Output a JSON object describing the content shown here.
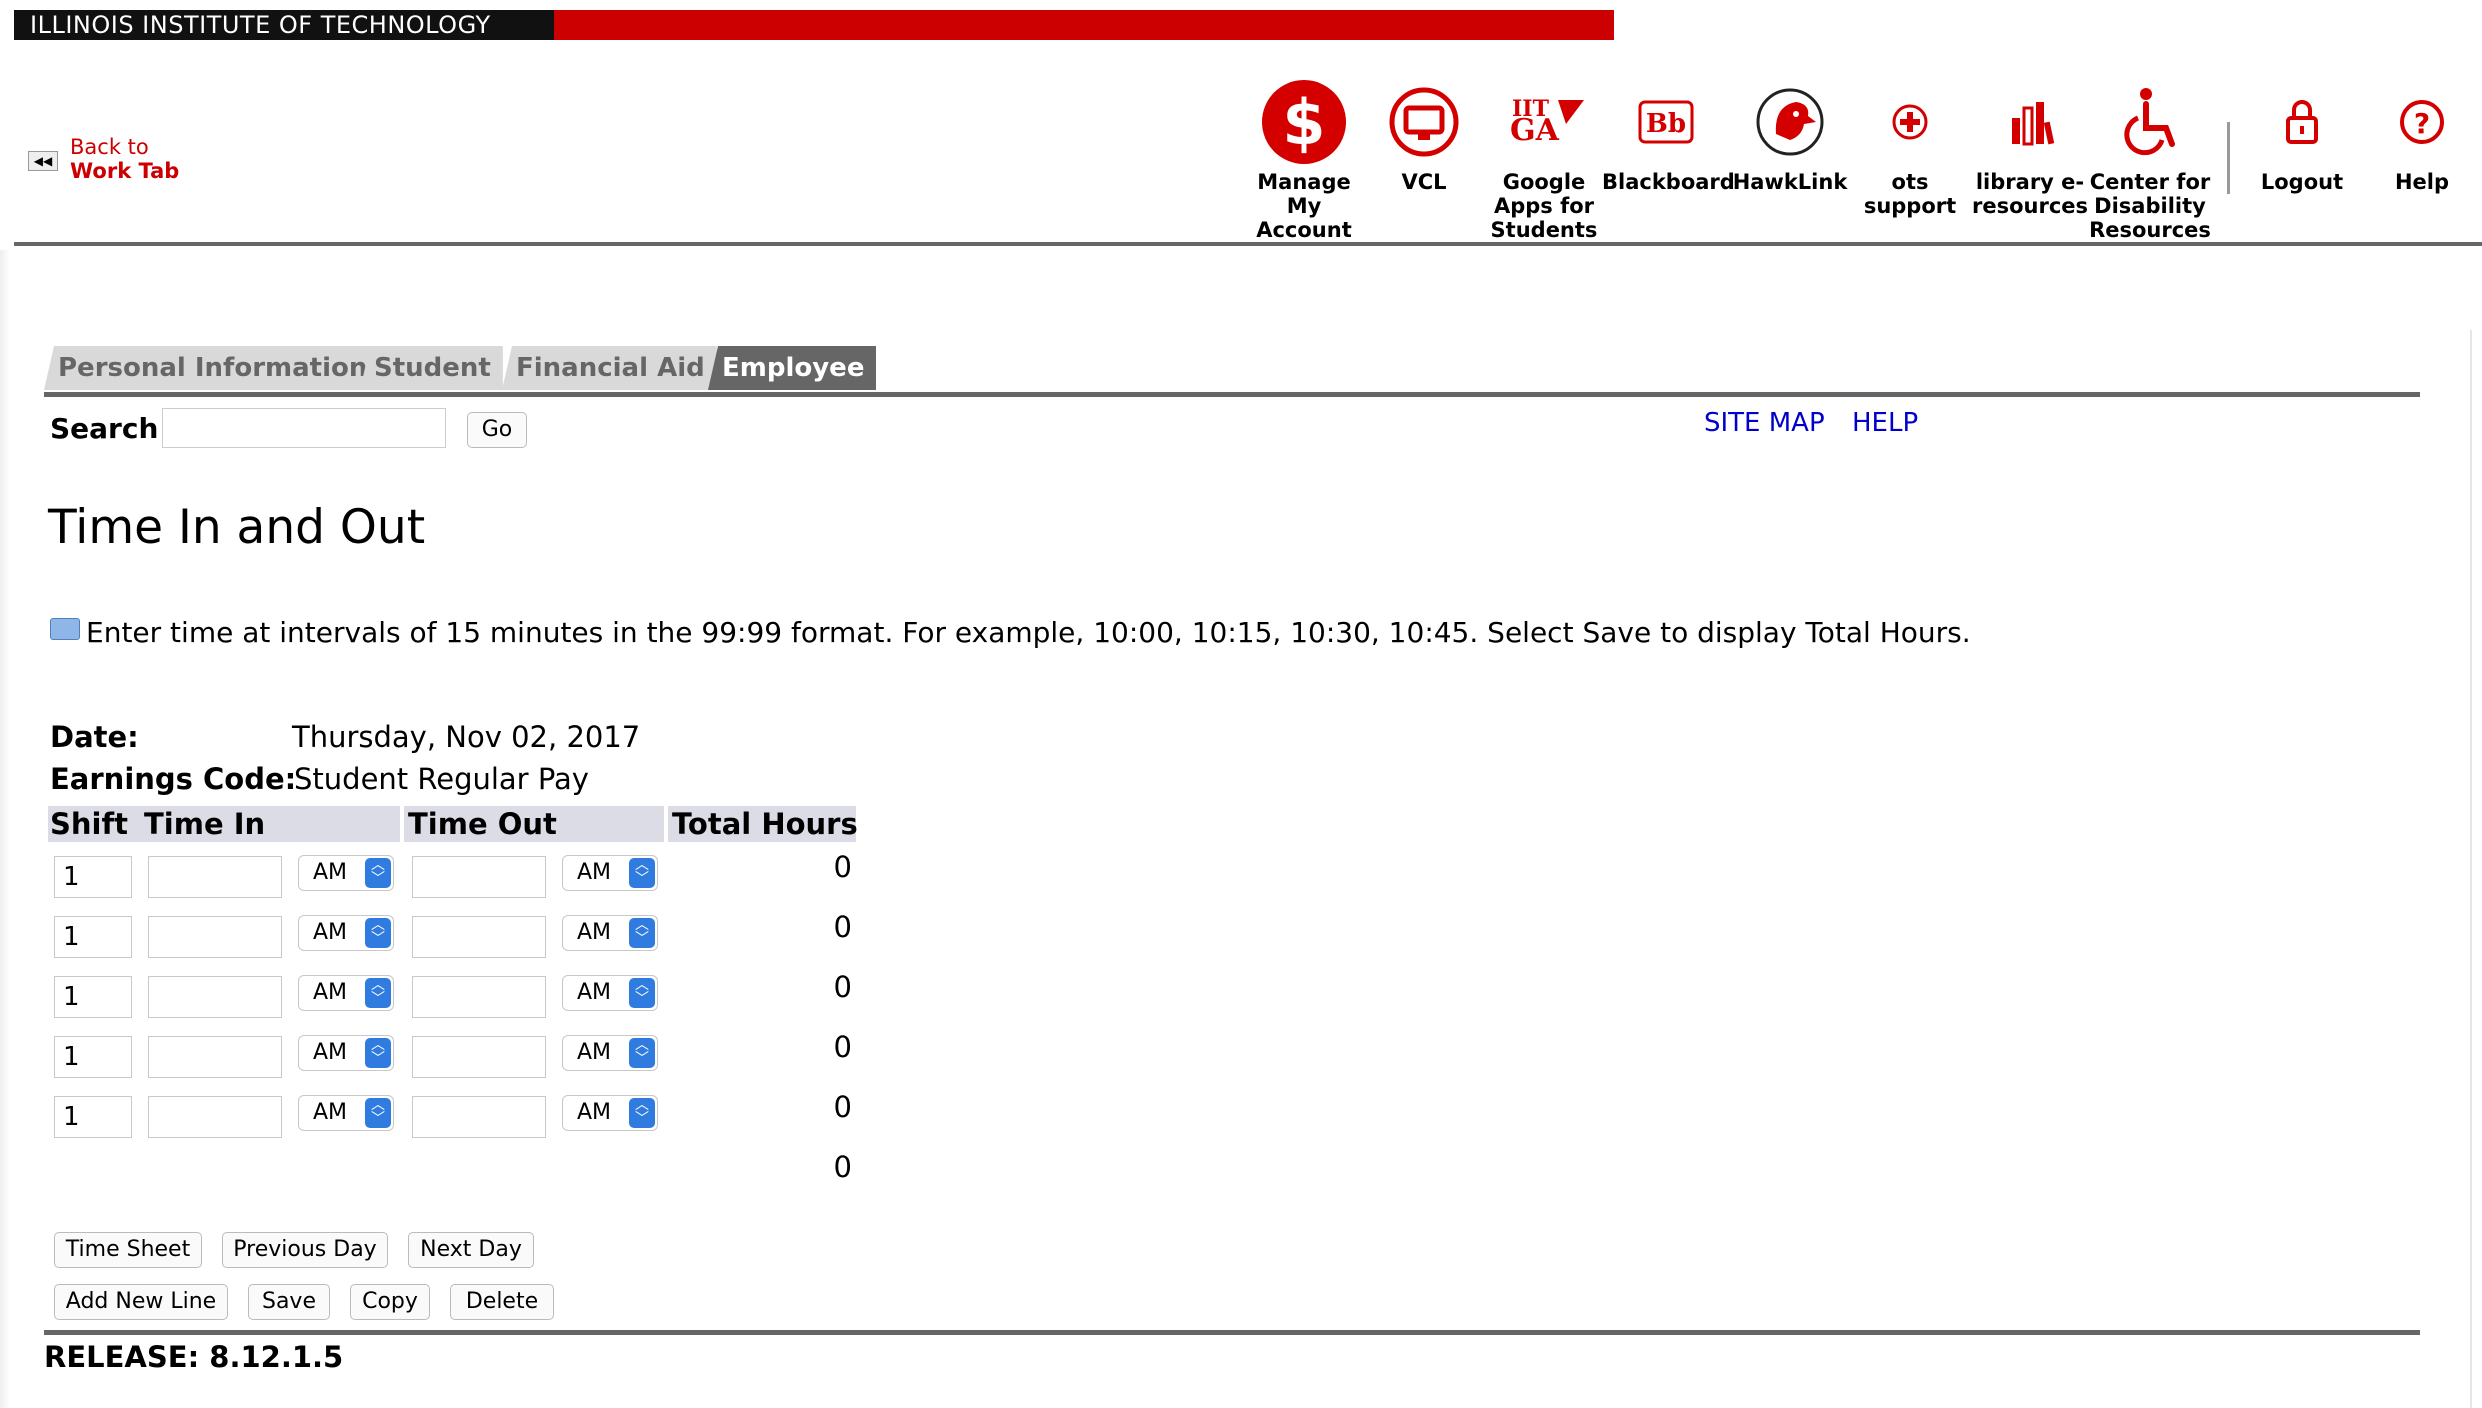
{
  "banner": {
    "title": "ILLINOIS INSTITUTE OF TECHNOLOGY"
  },
  "back_link": {
    "line1": "Back to",
    "line2": "Work Tab"
  },
  "header_links": [
    {
      "label": "Manage My Account",
      "icon": "dollar-icon"
    },
    {
      "label": "VCL",
      "icon": "monitor-icon"
    },
    {
      "label": "Google Apps for Students",
      "icon": "google-apps-icon"
    },
    {
      "label": "Blackboard",
      "icon": "blackboard-icon"
    },
    {
      "label": "HawkLink",
      "icon": "hawk-icon"
    },
    {
      "label": "ots support",
      "icon": "plus-icon"
    },
    {
      "label": "library e-resources",
      "icon": "books-icon"
    },
    {
      "label": "Center for Disability Resources",
      "icon": "wheelchair-icon"
    },
    {
      "label": "Logout",
      "icon": "lock-icon"
    },
    {
      "label": "Help",
      "icon": "question-icon"
    }
  ],
  "tabs": [
    {
      "label": "Personal Information",
      "active": false
    },
    {
      "label": "Student",
      "active": false
    },
    {
      "label": "Financial Aid",
      "active": false
    },
    {
      "label": "Employee",
      "active": true
    }
  ],
  "search": {
    "label": "Search",
    "value": "",
    "go_label": "Go"
  },
  "top_links": {
    "site_map": "SITE MAP",
    "help": "HELP"
  },
  "page": {
    "title": "Time In and Out",
    "info": "Enter time at intervals of 15 minutes in the 99:99 format. For example, 10:00, 10:15, 10:30, 10:45. Select Save to display Total Hours."
  },
  "details": {
    "date_label": "Date:",
    "date_value": "Thursday, Nov 02, 2017",
    "earnings_label": "Earnings Code:",
    "earnings_value": "Student Regular Pay"
  },
  "table": {
    "headers": {
      "shift": "Shift",
      "time_in": "Time In",
      "time_out": "Time Out",
      "total_hours": "Total Hours"
    },
    "rows": [
      {
        "shift": "1",
        "time_in": "",
        "in_ampm": "AM",
        "time_out": "",
        "out_ampm": "AM",
        "total": "0"
      },
      {
        "shift": "1",
        "time_in": "",
        "in_ampm": "AM",
        "time_out": "",
        "out_ampm": "AM",
        "total": "0"
      },
      {
        "shift": "1",
        "time_in": "",
        "in_ampm": "AM",
        "time_out": "",
        "out_ampm": "AM",
        "total": "0"
      },
      {
        "shift": "1",
        "time_in": "",
        "in_ampm": "AM",
        "time_out": "",
        "out_ampm": "AM",
        "total": "0"
      },
      {
        "shift": "1",
        "time_in": "",
        "in_ampm": "AM",
        "time_out": "",
        "out_ampm": "AM",
        "total": "0"
      }
    ],
    "grand_total": "0"
  },
  "buttons": {
    "time_sheet": "Time Sheet",
    "previous_day": "Previous Day",
    "next_day": "Next Day",
    "add_new_line": "Add New Line",
    "save": "Save",
    "copy": "Copy",
    "delete": "Delete"
  },
  "release": "RELEASE: 8.12.1.5",
  "colors": {
    "brand_red": "#cc0000",
    "link_blue": "#0000cc",
    "tab_gray": "#666666",
    "select_blue": "#2f7be0"
  }
}
